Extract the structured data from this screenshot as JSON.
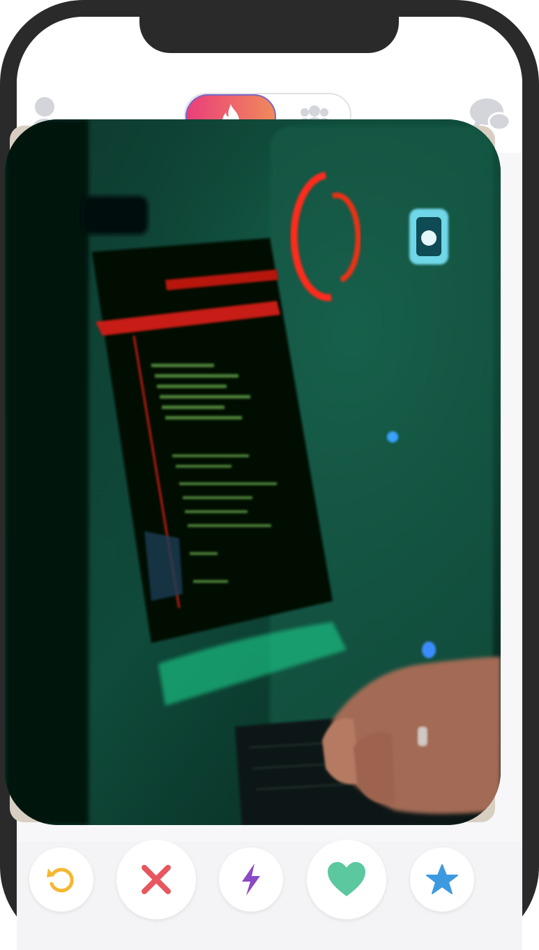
{
  "header": {
    "profile_icon": "profile-icon",
    "toggle": {
      "left_icon": "flame-icon",
      "right_icon": "group-icon",
      "selected": "left"
    },
    "chat_icon": "chat-icon"
  },
  "card": {
    "image_subject": "green-lit-computer-setup-with-hands-typing"
  },
  "actions": [
    {
      "name": "rewind",
      "icon": "rewind-icon",
      "color": "#f5b731"
    },
    {
      "name": "nope",
      "icon": "close-icon",
      "color": "#e8565e"
    },
    {
      "name": "boost",
      "icon": "lightning-icon",
      "color": "#8b49c6"
    },
    {
      "name": "like",
      "icon": "heart-icon",
      "color": "#5bc8a0"
    },
    {
      "name": "super-like",
      "icon": "star-icon",
      "color": "#3e9ae0"
    }
  ],
  "colors": {
    "frame": "#2a2a2a",
    "toggle_gradient_start": "#ea3d7b",
    "toggle_gradient_end": "#f08b5a",
    "icon_gray": "#d3d5da"
  }
}
